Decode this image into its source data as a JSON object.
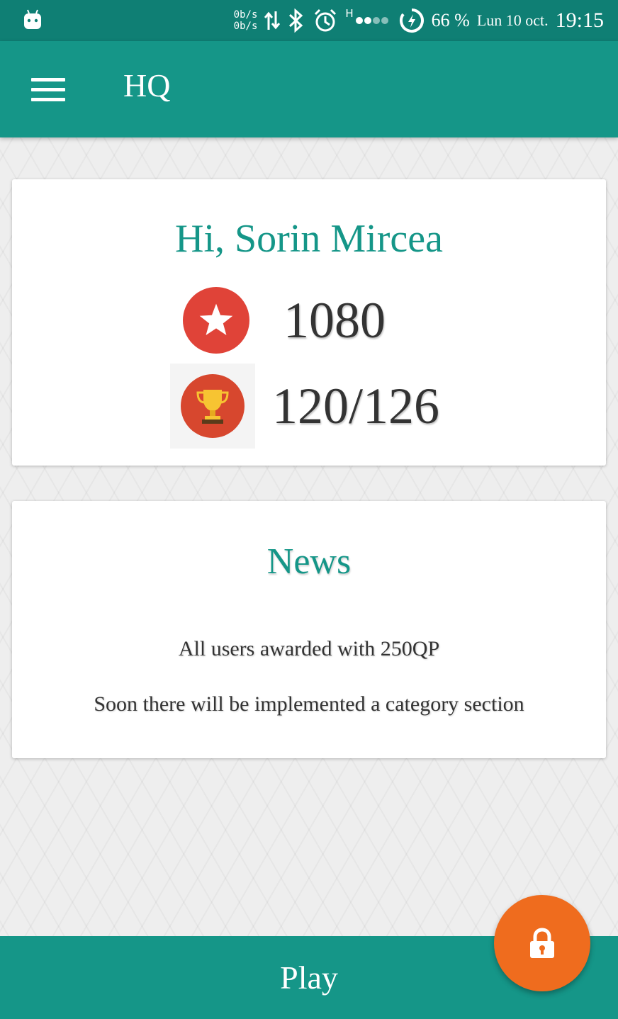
{
  "status_bar": {
    "net_up": "0b/s",
    "net_down": "0b/s",
    "network_type": "H",
    "battery_percent": "66 %",
    "date": "Lun 10 oct.",
    "time": "19:15"
  },
  "app_bar": {
    "title": "HQ",
    "menu_icon": "hamburger-menu-icon",
    "color": "#159688"
  },
  "profile": {
    "greeting": "Hi, Sorin Mircea",
    "points": "1080",
    "points_icon": "star-icon",
    "achievements": "120/126",
    "achievements_icon": "trophy-icon"
  },
  "news": {
    "title": "News",
    "items": [
      "All users awarded with 250QP",
      "Soon there will be implemented a category section"
    ]
  },
  "play_button": {
    "label": "Play"
  },
  "fab": {
    "icon": "lock-icon",
    "color": "#ef6c1e"
  },
  "colors": {
    "primary": "#159688",
    "status_bar": "#0f7f74",
    "accent": "#ef6c1e",
    "star_badge": "#e04338",
    "trophy_badge": "#d7472e"
  }
}
